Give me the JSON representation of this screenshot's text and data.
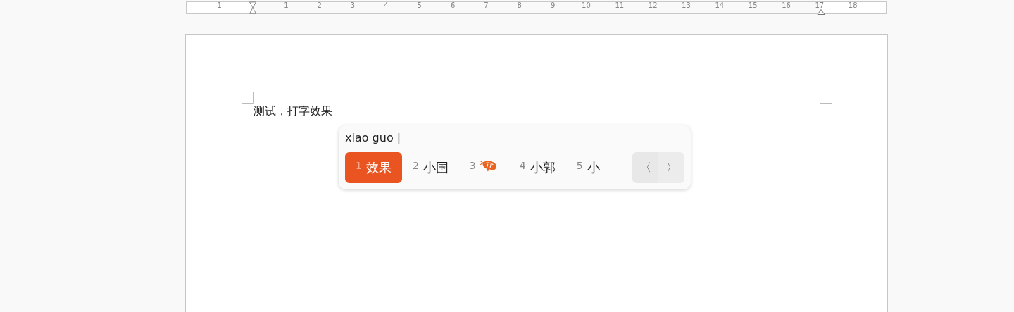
{
  "ruler": {
    "labels": [
      "1",
      "1",
      "2",
      "3",
      "4",
      "5",
      "6",
      "7",
      "8",
      "9",
      "10",
      "11",
      "12",
      "13",
      "14",
      "15",
      "16",
      "17",
      "18"
    ]
  },
  "document": {
    "text": "测试，打字",
    "preedit": "效果"
  },
  "input_method": {
    "preedit": "xiao guo |",
    "candidates": [
      {
        "index": "1",
        "text": "效果",
        "kind": "text",
        "selected": true
      },
      {
        "index": "2",
        "text": "小国",
        "kind": "text",
        "selected": false
      },
      {
        "index": "3",
        "kind": "emoji",
        "selected": false
      },
      {
        "index": "4",
        "text": "小郭",
        "kind": "text",
        "selected": false
      },
      {
        "index": "5",
        "text": "小",
        "kind": "text",
        "selected": false
      }
    ],
    "prev": "〈",
    "next": "〉"
  }
}
